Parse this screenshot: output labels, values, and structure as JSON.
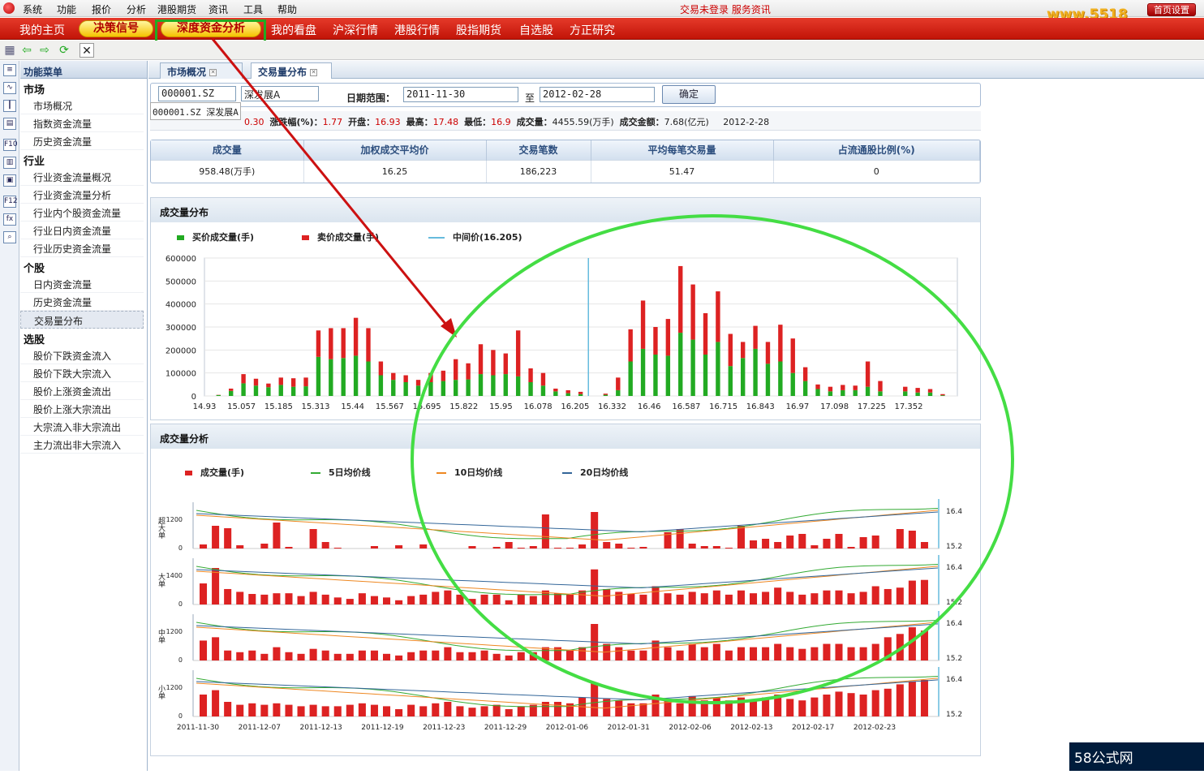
{
  "menubar": {
    "items": [
      "系统",
      "功能",
      "报价",
      "分析",
      "港股期货",
      "资讯",
      "工具",
      "帮助"
    ],
    "status": "交易未登录 服务资讯",
    "site": "www.5518",
    "home_btn": "首页设置"
  },
  "nav": {
    "items": [
      "我的主页",
      "决策信号",
      "深度资金分析",
      "我的看盘",
      "沪深行情",
      "港股行情",
      "股指期货",
      "自选股",
      "方正研究"
    ]
  },
  "sidebar": {
    "title": "功能菜单",
    "groups": [
      {
        "label": "市场",
        "items": [
          "市场概况",
          "指数资金流量",
          "历史资金流量"
        ]
      },
      {
        "label": "行业",
        "items": [
          "行业资金流量概况",
          "行业资金流量分析",
          "行业内个股资金流量",
          "行业日内资金流量",
          "行业历史资金流量"
        ]
      },
      {
        "label": "个股",
        "items": [
          "日内资金流量",
          "历史资金流量",
          "交易量分布"
        ]
      },
      {
        "label": "选股",
        "items": [
          "股价下跌资金流入",
          "股价下跌大宗流入",
          "股价上涨资金流出",
          "股价上涨大宗流出",
          "大宗流入非大宗流出",
          "主力流出非大宗流入"
        ]
      }
    ]
  },
  "tabs": [
    "市场概况",
    "交易量分布"
  ],
  "query": {
    "code": "000001.SZ",
    "name": "深发展A",
    "date_label": "日期范围：",
    "start": "2011-11-30",
    "to": "至",
    "end": "2012-02-28",
    "ok": "确定",
    "dropdown": "000001.SZ 深发展A"
  },
  "quote": {
    "chg": "0.30",
    "pct_label": "涨跌幅(%)：",
    "pct": "1.77",
    "open_label": "开盘：",
    "open": "16.93",
    "high_label": "最高：",
    "high": "17.48",
    "low_label": "最低：",
    "low": "16.9",
    "vol_label": "成交量：",
    "vol": "4455.59(万手)",
    "amt_label": "成交金额：",
    "amt": "7.68(亿元)",
    "date": "2012-2-28"
  },
  "stats": {
    "headers": [
      "成交量",
      "加权成交平均价",
      "交易笔数",
      "平均每笔交易量",
      "占流通股比例(%)"
    ],
    "values": [
      "958.48(万手)",
      "16.25",
      "186,223",
      "51.47",
      "0"
    ]
  },
  "colors": {
    "buy": "#22aa22",
    "sell": "#dd2222",
    "mid": "#66bbdd",
    "ma5": "#33aa33",
    "ma10": "#ee8822",
    "ma20": "#336699",
    "nav_red": "#d01c10",
    "ellipse": "#44dd44",
    "arrow": "#cc1111"
  },
  "chart1": {
    "title": "成交量分布",
    "legend": [
      "买价成交量(手)",
      "卖价成交量(手)",
      "中间价(16.205)"
    ]
  },
  "chart2": {
    "title": "成交量分析",
    "legend": [
      "成交量(手)",
      "5日均价线",
      "10日均价线",
      "20日均价线"
    ]
  },
  "chart_data": [
    {
      "type": "bar",
      "title": "成交量分布",
      "ylim": [
        0,
        600000
      ],
      "yticks": [
        "600000",
        "500000",
        "400000",
        "300000",
        "200000",
        "100000",
        "0"
      ],
      "xticks": [
        "14.93",
        "15.057",
        "15.185",
        "15.313",
        "15.44",
        "15.567",
        "15.695",
        "15.822",
        "15.95",
        "16.078",
        "16.205",
        "16.332",
        "16.46",
        "16.587",
        "16.715",
        "16.843",
        "16.97",
        "17.098",
        "17.225",
        "17.352"
      ],
      "mid": 16.205,
      "series": [
        {
          "name": "买价成交量(手)",
          "values": [
            4000,
            22000,
            55000,
            45000,
            38000,
            48000,
            40000,
            42000,
            170000,
            160000,
            165000,
            175000,
            150000,
            90000,
            70000,
            60000,
            45000,
            60000,
            65000,
            70000,
            72000,
            95000,
            90000,
            95000,
            85000,
            60000,
            45000,
            20000,
            12000,
            8000,
            0,
            5000,
            25000,
            150000,
            205000,
            180000,
            175000,
            275000,
            245000,
            180000,
            235000,
            130000,
            165000,
            205000,
            140000,
            150000,
            100000,
            65000,
            30000,
            20000,
            25000,
            25000,
            40000,
            20000,
            0,
            20000,
            15000,
            15000,
            3000
          ]
        },
        {
          "name": "卖价成交量(手)",
          "values": [
            1000,
            10000,
            40000,
            30000,
            16000,
            32000,
            37000,
            38000,
            115000,
            135000,
            130000,
            165000,
            145000,
            60000,
            30000,
            30000,
            25000,
            40000,
            45000,
            90000,
            70000,
            130000,
            110000,
            90000,
            200000,
            60000,
            55000,
            12000,
            13000,
            10000,
            0,
            5000,
            55000,
            140000,
            210000,
            120000,
            160000,
            290000,
            240000,
            180000,
            220000,
            140000,
            70000,
            100000,
            95000,
            160000,
            150000,
            60000,
            20000,
            20000,
            23000,
            20000,
            110000,
            45000,
            0,
            20000,
            20000,
            15000,
            5000
          ]
        }
      ]
    },
    {
      "type": "bar",
      "title": "成交量分析",
      "categories": [
        "2011-11-30",
        "2011-12-07",
        "2011-12-13",
        "2011-12-19",
        "2011-12-23",
        "2011-12-29",
        "2012-01-06",
        "2012-01-31",
        "2012-02-06",
        "2012-02-13",
        "2012-02-17",
        "2012-02-23"
      ],
      "right_ticks": [
        "16.4",
        "15.2"
      ],
      "panels": [
        {
          "ylabel": "超大单",
          "ytick": "1200"
        },
        {
          "ylabel": "大单",
          "ytick": "1400"
        },
        {
          "ylabel": "中单",
          "ytick": "1200"
        },
        {
          "ylabel": "小单",
          "ytick": "1200"
        }
      ]
    }
  ]
}
